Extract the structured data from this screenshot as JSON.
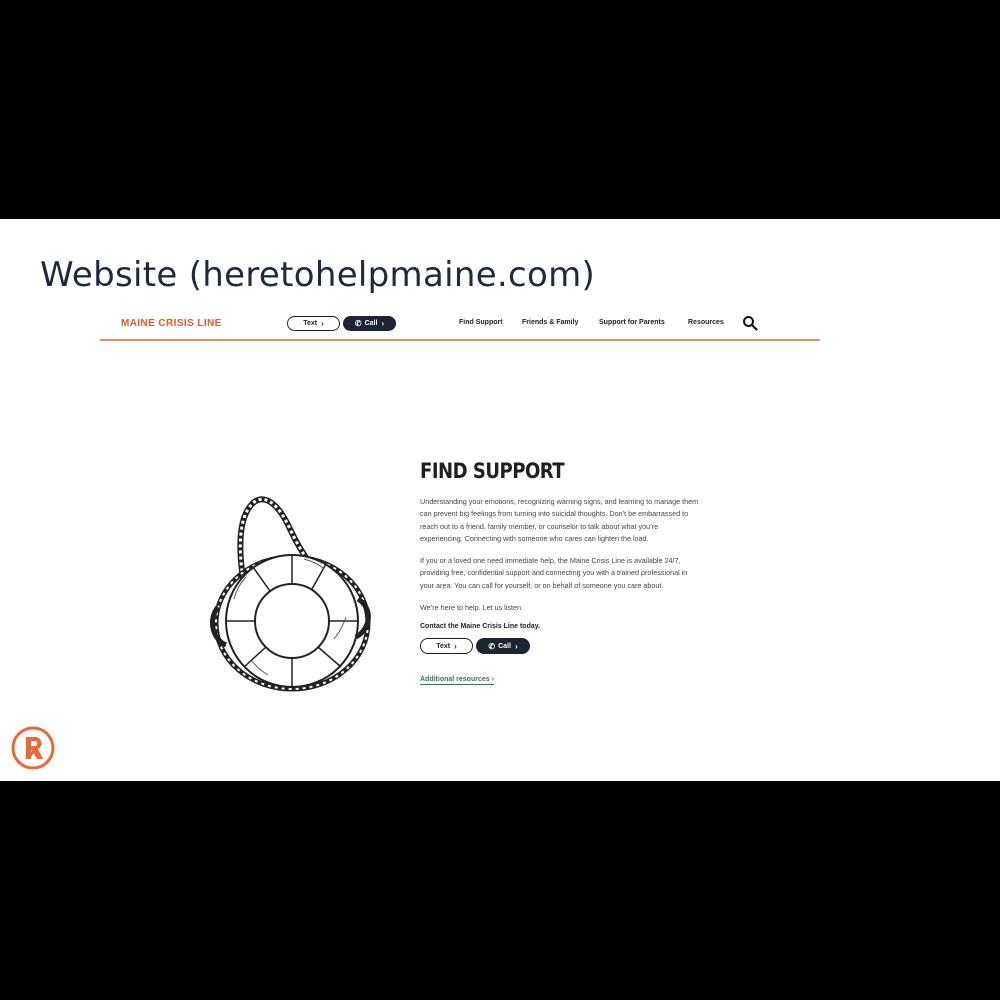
{
  "slide": {
    "title": "Website (heretohelpmaine.com)"
  },
  "site": {
    "logo": "MAINE CRISIS LINE",
    "header_text_button": "Text",
    "header_call_button": "Call",
    "nav": [
      "Find Support",
      "Friends & Family",
      "Support for Parents",
      "Resources"
    ],
    "hero": {
      "title": "FIND SUPPORT",
      "paragraphs": [
        "Understanding your emotions, recognizing warning signs, and learning to manage them can prevent big feelings from turning into suicidal thoughts. Don’t be embarrassed to reach out to a friend, family member, or counselor to talk about what you’re experiencing. Connecting with someone who cares can lighten the load.",
        "If you or a loved one need immediate help, the Maine Crisis Line is available 24/7, providing free, confidential support and connecting you with a trained professional in your area. You can call for yourself, or on behalf of someone you care about.",
        "We’re here to help. Let us listen."
      ],
      "contact_line": "Contact the Maine Crisis Line today.",
      "text_button": "Text",
      "call_button": "Call",
      "resources_link": "Additional resources"
    }
  },
  "icons": {
    "search": "search-icon",
    "chevron": "chevron-right-icon",
    "phone": "phone-icon",
    "illustration": "life-ring-illustration",
    "badge": "brand-logo"
  },
  "colors": {
    "brand_orange": "#e05a24",
    "header_rule": "#e98a62",
    "dark_button": "#1d2433",
    "link_green": "#2c7a4f"
  }
}
